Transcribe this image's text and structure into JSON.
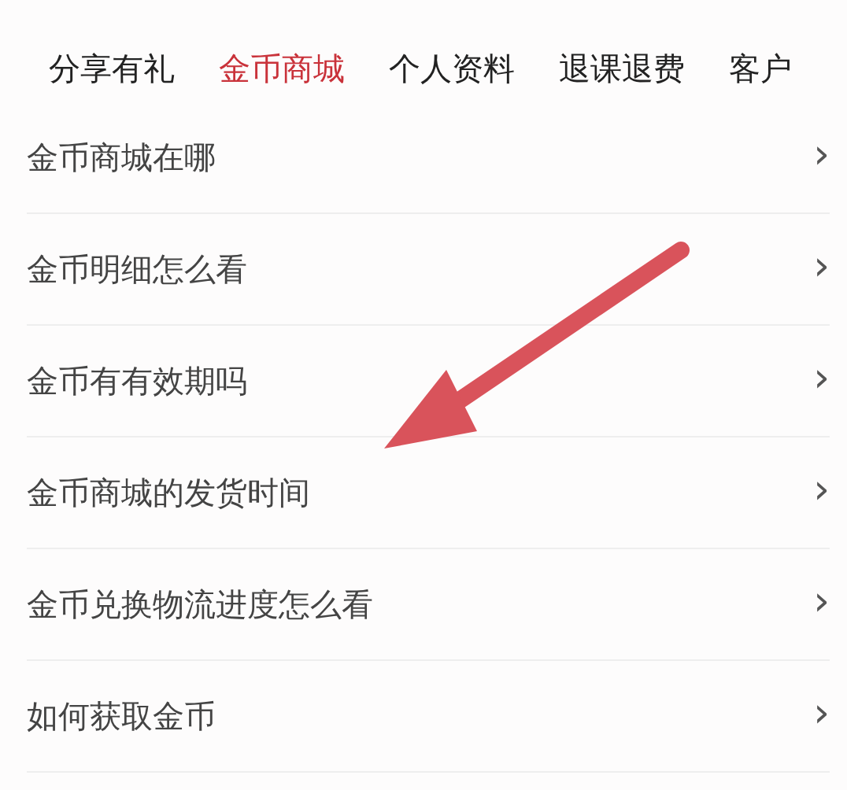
{
  "tabs": [
    {
      "label": "分享有礼",
      "selected": false
    },
    {
      "label": "金币商城",
      "selected": true
    },
    {
      "label": "个人资料",
      "selected": false
    },
    {
      "label": "退课退费",
      "selected": false
    },
    {
      "label": "客户",
      "selected": false
    }
  ],
  "questions": [
    {
      "label": "金币商城在哪",
      "chevron": "›"
    },
    {
      "label": "金币明细怎么看",
      "chevron": "›"
    },
    {
      "label": "金币有有效期吗",
      "chevron": "›"
    },
    {
      "label": "金币商城的发货时间",
      "chevron": "›"
    },
    {
      "label": "金币兑换物流进度怎么看",
      "chevron": "›"
    },
    {
      "label": "如何获取金币",
      "chevron": "›"
    }
  ]
}
